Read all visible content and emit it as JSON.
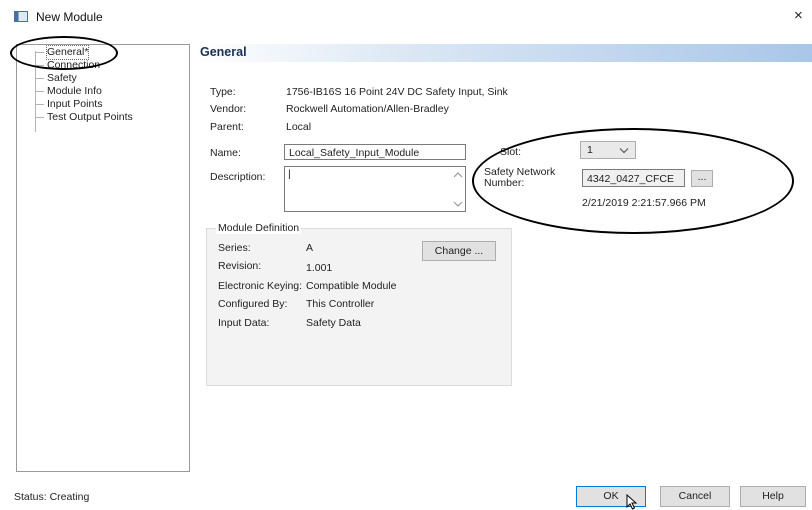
{
  "window": {
    "title": "New Module",
    "close_glyph": "×"
  },
  "tree": {
    "items": [
      "General*",
      "Connection",
      "Safety",
      "Module Info",
      "Input Points",
      "Test Output Points"
    ],
    "selected_index": 0
  },
  "panel": {
    "header": "General"
  },
  "fields": {
    "type_label": "Type:",
    "type_value": "1756-IB16S 16 Point 24V DC Safety Input, Sink",
    "vendor_label": "Vendor:",
    "vendor_value": "Rockwell Automation/Allen-Bradley",
    "parent_label": "Parent:",
    "parent_value": "Local",
    "name_label": "Name:",
    "name_value": "Local_Safety_Input_Module",
    "description_label": "Description:",
    "description_value": "|",
    "slot_label": "Slot:",
    "slot_value": "1",
    "snn_label_line1": "Safety Network",
    "snn_label_line2": "Number:",
    "snn_value": "4342_0427_CFCE",
    "snn_browse_label": "...",
    "timestamp": "2/21/2019 2:21:57.966 PM"
  },
  "module_definition": {
    "title": "Module Definition",
    "series_label": "Series:",
    "series_value": "A",
    "revision_label": "Revision:",
    "revision_value": "1.001",
    "keying_label": "Electronic Keying:",
    "keying_value": "Compatible Module",
    "configured_label": "Configured By:",
    "configured_value": "This Controller",
    "input_label": "Input Data:",
    "input_value": "Safety Data",
    "change_button": "Change ..."
  },
  "footer": {
    "status": "Status: Creating",
    "ok": "OK",
    "cancel": "Cancel",
    "help": "Help"
  },
  "icons": {
    "window_icon": "window-icon",
    "close": "close-icon",
    "dropdown": "chevron-down-icon",
    "scroll_up": "scroll-up-icon",
    "scroll_down": "scroll-down-icon",
    "cursor": "mouse-cursor-icon"
  }
}
